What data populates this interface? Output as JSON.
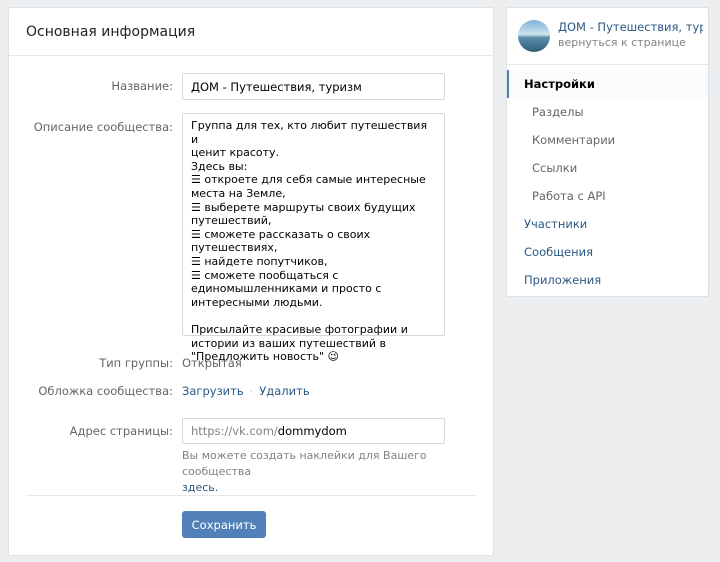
{
  "main": {
    "title": "Основная информация",
    "name_label": "Название:",
    "name_value": "ДОМ - Путешествия, туризм",
    "desc_label": "Описание сообщества:",
    "desc_value": "Группа для тех, кто любит путешествия и\nценит красоту.\nЗдесь вы:\n☰ откроете для себя самые интересные\nместа на Земле,\n☰ выберете маршруты своих будущих\nпутешествий,\n☰ сможете рассказать о своих путешествиях,\n☰ найдете попутчиков,\n☰ сможете пообщаться с\nединомышленниками и просто с\nинтересными людьми.\n\nПрисылайте красивые фотографии и\nистории из ваших путешествий в\n\"Предложить новость\" 😉",
    "type_label": "Тип группы:",
    "type_value": "Открытая",
    "cover_label": "Обложка сообщества:",
    "cover_upload": "Загрузить",
    "cover_sep": "·",
    "cover_delete": "Удалить",
    "address_label": "Адрес страницы:",
    "address_prefix": "https://vk.com/",
    "address_value": "dommydom",
    "hint_text": "Вы можете создать наклейки для Вашего сообщества",
    "hint_link": "здесь.",
    "save_label": "Сохранить"
  },
  "side": {
    "group_name": "ДОМ - Путешествия, тури...",
    "back_link": "вернуться к странице",
    "menu": [
      {
        "label": "Настройки"
      },
      {
        "label": "Разделы"
      },
      {
        "label": "Комментарии"
      },
      {
        "label": "Ссылки"
      },
      {
        "label": "Работа с API"
      },
      {
        "label": "Участники"
      },
      {
        "label": "Сообщения"
      },
      {
        "label": "Приложения"
      }
    ]
  },
  "colors": {
    "accent": "#5181b8",
    "link": "#2a5885",
    "background": "#edeef0"
  }
}
